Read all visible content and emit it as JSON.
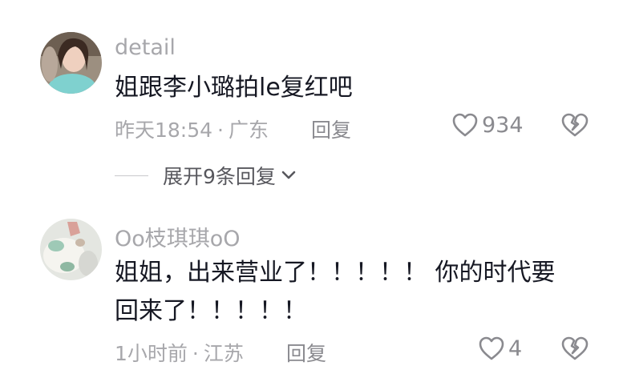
{
  "comments": [
    {
      "username": "detail",
      "text_lines": [
        "姐跟李小璐拍le复红吧"
      ],
      "time": "昨天18:54",
      "location": "广东",
      "reply_label": "回复",
      "likes": "934",
      "expand_label": "展开9条回复"
    },
    {
      "username": "Oo枝琪琪oO",
      "text_lines": [
        "姐姐，出来营业了！！！！！ 你的时代要",
        "回来了！！！！！"
      ],
      "time": "1小时前",
      "location": "江苏",
      "reply_label": "回复",
      "likes": "4"
    }
  ],
  "meta_separator": "·",
  "colors": {
    "text_primary": "#161823",
    "text_secondary": "#a7a7ab",
    "icon_gray": "#8a8a8f"
  }
}
